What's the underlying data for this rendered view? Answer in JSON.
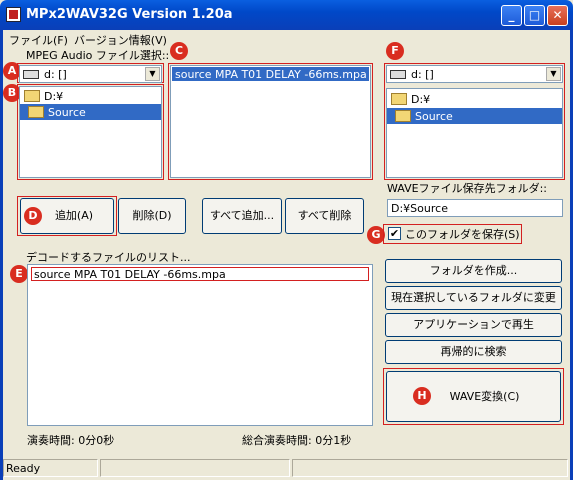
{
  "window": {
    "title": "MPx2WAV32G Version 1.20a",
    "minimize": "_",
    "maximize": "□",
    "close": "✕"
  },
  "menu": {
    "file": "ファイル(F)",
    "version": "バージョン情報(V)"
  },
  "source": {
    "group_label": "MPEG Audio ファイル選択::",
    "drive_value": "d: []",
    "folders": [
      "D:¥",
      "Source"
    ],
    "files": [
      "source MPA T01 DELAY -66ms.mpa"
    ]
  },
  "dest": {
    "drive_value": "d: []",
    "folders": [
      "D:¥",
      "Source"
    ],
    "folder_label": "WAVEファイル保存先フォルダ::",
    "folder_value": "D:¥Source",
    "save_checkbox_label": "このフォルダを保存(S)",
    "save_checked": true
  },
  "buttons": {
    "add": "追加(A)",
    "remove": "削除(D)",
    "add_all": "すべて追加...",
    "remove_all": "すべて削除",
    "create_folder": "フォルダを作成...",
    "change_to_selected": "現在選択しているフォルダに変更",
    "play_app": "アプリケーションで再生",
    "recursive_search": "再帰的に検索",
    "convert": "WAVE変換(C)"
  },
  "decode_list": {
    "label": "デコードするファイルのリスト...",
    "items": [
      "source MPA T01 DELAY -66ms.mpa"
    ]
  },
  "times": {
    "play_time": "演奏時間: 0分0秒",
    "total_time": "総合演奏時間: 0分1秒"
  },
  "status": {
    "text": "Ready"
  },
  "markers": [
    "A",
    "B",
    "C",
    "D",
    "E",
    "F",
    "G",
    "H"
  ],
  "colors": {
    "titlebar": "#0a5fe0",
    "marker": "#d92d20",
    "highlight": "#316ac5",
    "window_bg": "#ece9d8"
  }
}
